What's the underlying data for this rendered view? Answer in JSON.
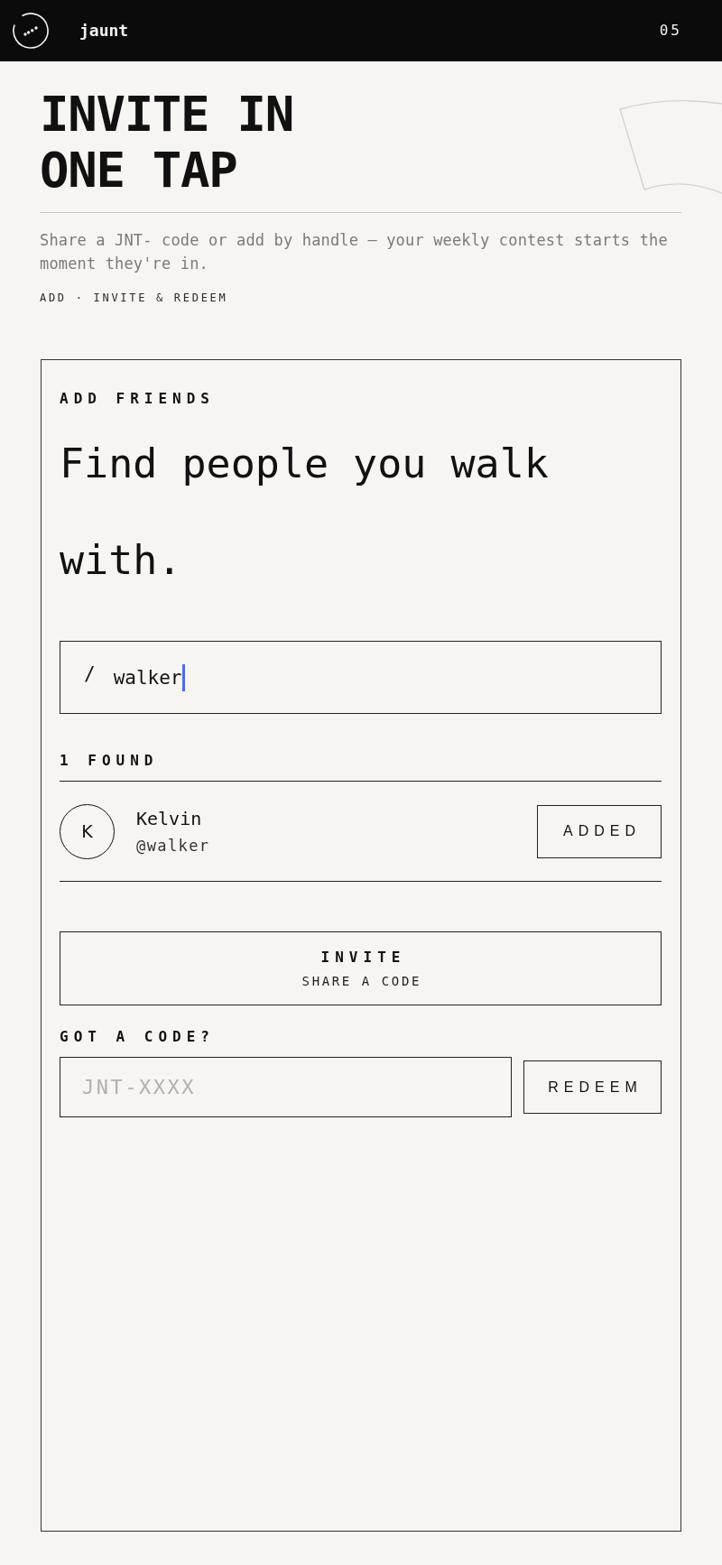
{
  "header": {
    "brand": "jaunt",
    "step": "05"
  },
  "hero": {
    "title": "INVITE IN ONE TAP",
    "subtitle": "Share a JNT- code or add by handle — your weekly contest starts the moment they're in.",
    "breadcrumb": "ADD · INVITE & REDEEM"
  },
  "card": {
    "label": "ADD FRIENDS",
    "headline": "Find people you walk with.",
    "search": {
      "prefix": "/",
      "value": "walker",
      "focused": true
    },
    "results_label": "1 FOUND",
    "results": [
      {
        "initial": "K",
        "name": "Kelvin",
        "handle": "@walker",
        "action": "ADDED"
      }
    ],
    "invite_button": {
      "label": "INVITE",
      "sublabel": "SHARE A CODE"
    },
    "code_label": "GOT A CODE?",
    "code_field": {
      "placeholder": "JNT-XXXX"
    },
    "redeem_button": "REDEEM"
  }
}
